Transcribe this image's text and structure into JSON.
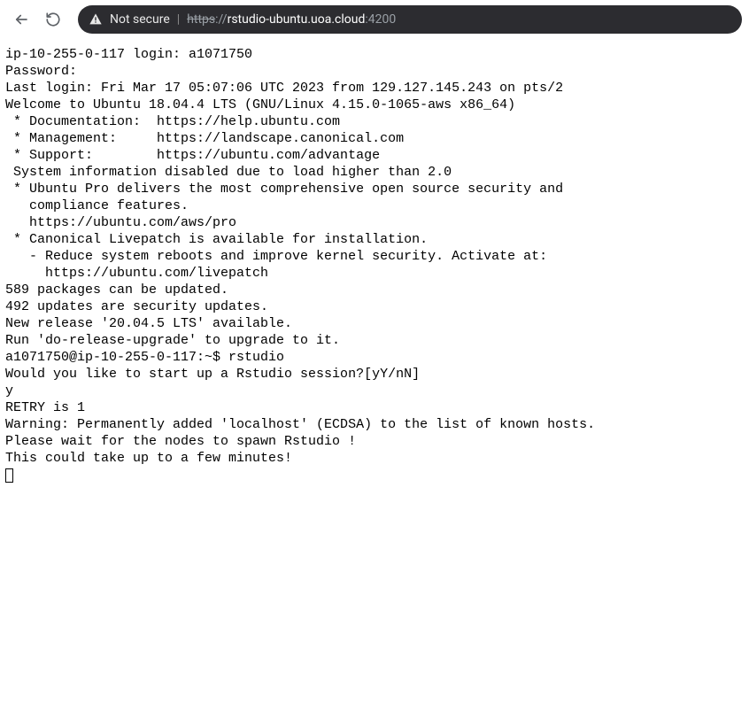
{
  "browser": {
    "not_secure": "Not secure",
    "url_protocol": "https",
    "url_sep": "://",
    "url_host": "rstudio-ubuntu.uoa.cloud",
    "url_port": ":4200",
    "separator": "|"
  },
  "terminal": {
    "lines": {
      "l01": "ip-10-255-0-117 login: a1071750",
      "l02": "Password:",
      "l03": "Last login: Fri Mar 17 05:07:06 UTC 2023 from 129.127.145.243 on pts/2",
      "l04": "Welcome to Ubuntu 18.04.4 LTS (GNU/Linux 4.15.0-1065-aws x86_64)",
      "l05": "",
      "l06": " * Documentation:  https://help.ubuntu.com",
      "l07": " * Management:     https://landscape.canonical.com",
      "l08": " * Support:        https://ubuntu.com/advantage",
      "l09": "",
      "l10": " System information disabled due to load higher than 2.0",
      "l11": "",
      "l12": " * Ubuntu Pro delivers the most comprehensive open source security and",
      "l13": "   compliance features.",
      "l14": "",
      "l15": "   https://ubuntu.com/aws/pro",
      "l16": "",
      "l17": " * Canonical Livepatch is available for installation.",
      "l18": "   - Reduce system reboots and improve kernel security. Activate at:",
      "l19": "     https://ubuntu.com/livepatch",
      "l20": "",
      "l21": "589 packages can be updated.",
      "l22": "492 updates are security updates.",
      "l23": "",
      "l24": "New release '20.04.5 LTS' available.",
      "l25": "Run 'do-release-upgrade' to upgrade to it.",
      "l26": "",
      "l27": "",
      "l28": "a1071750@ip-10-255-0-117:~$ rstudio",
      "l29": "Would you like to start up a Rstudio session?[yY/nN]",
      "l30": "y",
      "l31": "RETRY is 1",
      "l32": "",
      "l33": "Warning: Permanently added 'localhost' (ECDSA) to the list of known hosts.",
      "l34": "Please wait for the nodes to spawn Rstudio !",
      "l35": "",
      "l36": "This could take up to a few minutes!",
      "l37": ""
    }
  }
}
